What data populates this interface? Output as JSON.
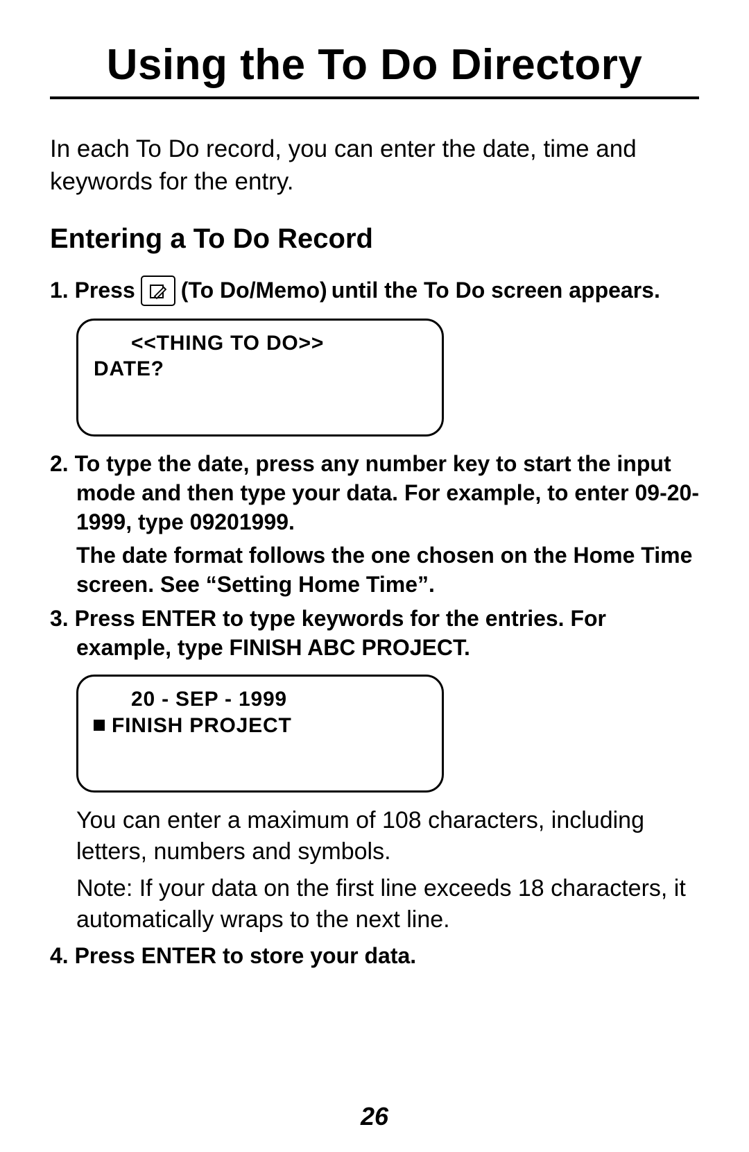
{
  "title": "Using the To Do Directory",
  "intro": "In each To Do record, you can enter the date, time and keywords for the entry.",
  "subheading": "Entering a To Do Record",
  "step1_a": "1. Press",
  "step1_icon_label": "To Do/Memo",
  "step1_b": "until the To Do screen appears.",
  "screen1": {
    "line1": "<<THING TO DO>>",
    "line2": "DATE?"
  },
  "step2": "2. To type the date, press any number key to start the input mode and then type your data. For example, to enter 09-20-1999, type 09201999.",
  "step2_body": "The date format follows the one chosen on the Home Time screen. See “Setting Home Time”.",
  "step3": "3. Press ENTER to type keywords for the entries. For example, type FINISH ABC PROJECT.",
  "screen2": {
    "line1": "20 - SEP - 1999",
    "line2": "FINISH PROJECT"
  },
  "note1": "You can enter a maximum of 108 characters, including letters, numbers and symbols.",
  "note2": "Note: If your data on the first line exceeds 18 characters, it automatically wraps to the next line.",
  "step4": "4. Press ENTER to store your data.",
  "page_number": "26"
}
